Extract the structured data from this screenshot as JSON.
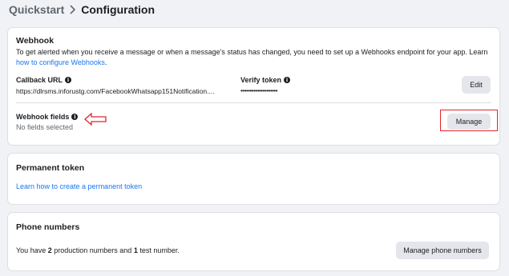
{
  "breadcrumb": {
    "root": "Quickstart",
    "separator": ">",
    "current": "Configuration"
  },
  "webhook": {
    "title": "Webhook",
    "description": "To get alerted when you receive a message or when a message's status has changed, you need to set up a Webhooks endpoint for your app. Learn",
    "description_link": "how to configure Webhooks",
    "description_end": ".",
    "callback_url_label": "Callback URL",
    "callback_url_value": "https://dlrsms.inforustg.com/FacebookWhatsapp151Notification....",
    "verify_token_label": "Verify token",
    "verify_token_value": "••••••••••••••••••••",
    "edit_label": "Edit",
    "fields_label": "Webhook fields",
    "fields_value": "No fields selected",
    "manage_label": "Manage"
  },
  "permanent_token": {
    "title": "Permanent token",
    "link": "Learn how to create a permanent token"
  },
  "phone_numbers": {
    "title": "Phone numbers",
    "text_1": "You have ",
    "production_count": "2",
    "text_2": " production numbers and ",
    "test_count": "1",
    "text_3": " test number.",
    "button_label": "Manage phone numbers"
  },
  "icons": {
    "info": "info-icon",
    "annotation_arrow": "left-arrow-icon",
    "separator": "chevron-right-icon"
  },
  "colors": {
    "link": "#1877f2",
    "annotation": "#e0262b",
    "button_bg": "#e4e6eb",
    "page_bg": "#f0f2f5"
  }
}
